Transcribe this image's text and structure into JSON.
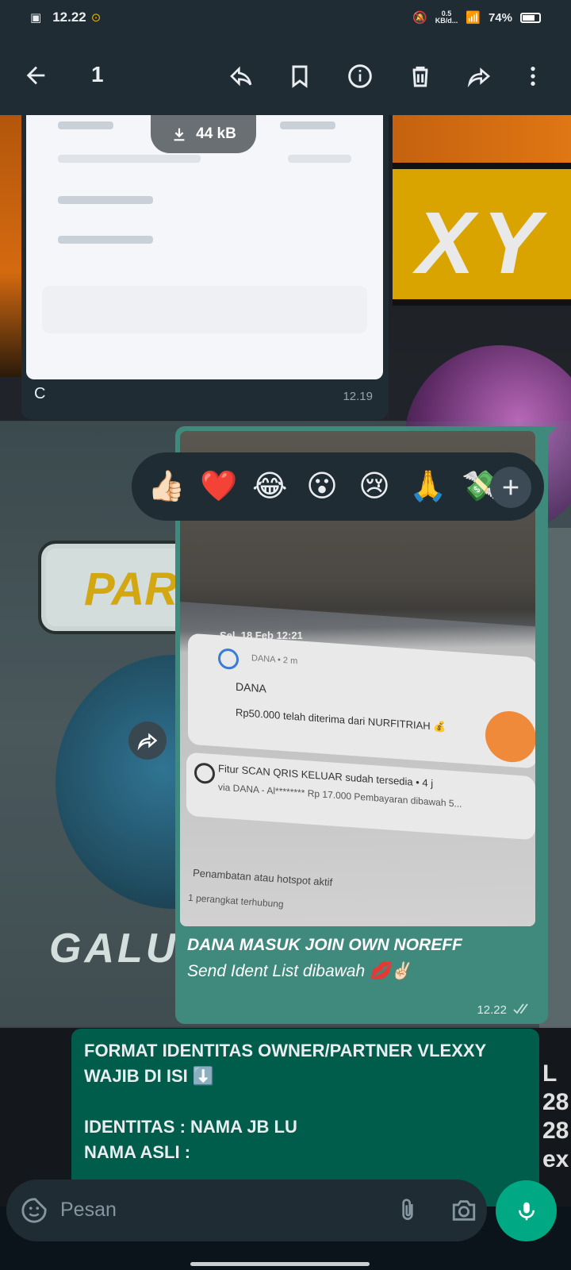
{
  "status_bar": {
    "time": "12.22",
    "net_speed_top": "0.5",
    "net_speed_unit": "KB/d...",
    "battery": "74%"
  },
  "app_bar": {
    "selected_count": "1"
  },
  "image_message": {
    "download_size": "44 kB",
    "caption": "C",
    "time": "12.19"
  },
  "reactions": [
    "👍🏻",
    "❤️",
    "😂",
    "😮",
    "😢",
    "🙏",
    "💸"
  ],
  "sent_message": {
    "photo_text": {
      "date": "Sel, 18 Feb 12:21",
      "notif1_app": "DANA • 2 m",
      "notif1_title": "DANA",
      "notif1_body": "Rp50.000 telah diterima dari NURFITRIAH 💰",
      "notif2_title": "Fitur SCAN QRIS KELUAR sudah tersedia • 4 j",
      "notif2_body": "via DANA - Al******** Rp 17.000 Pembayaran dibawah 5...",
      "hotspot": "Penambatan atau hotspot aktif",
      "hotspot_sub": "1 perangkat terhubung"
    },
    "line1": "DANA MASUK JOIN OWN NOREFF",
    "line2": "Send Ident List dibawah 💋✌🏻",
    "time": "12.22"
  },
  "format_message": {
    "text": "FORMAT IDENTITAS OWNER/PARTNER VLEXXY\nWAJIB DI ISI ⬇️\n\nIDENTITAS : NAMA JB LU\nNAMA ASLI :"
  },
  "input": {
    "placeholder": "Pesan"
  },
  "colors": {
    "header": "#1f2c34",
    "sent_bubble": "#40897d",
    "outgoing": "#005c4b",
    "accent": "#00a884"
  }
}
